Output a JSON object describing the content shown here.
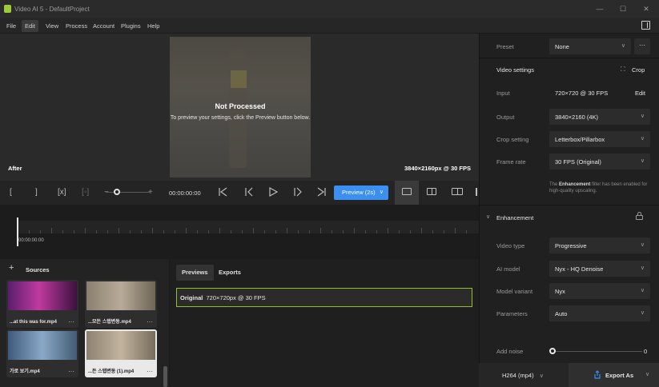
{
  "window": {
    "title": "Video AI 5 - DefaultProject",
    "controls": {
      "minimize": "—",
      "maximize": "☐",
      "close": "✕"
    }
  },
  "menu": [
    "File",
    "Edit",
    "View",
    "Process",
    "Account",
    "Plugins",
    "Help"
  ],
  "viewer": {
    "status_title": "Not Processed",
    "status_hint": "To preview your settings, click the Preview button below.",
    "side_label": "After",
    "resolution_label": "3840×2160px @ 30 FPS"
  },
  "controls": {
    "mark_in": "[",
    "mark_out": "]",
    "clear_marks": "[x]",
    "mark_segment": "[◦]",
    "zoom_minus": "−",
    "zoom_plus": "+",
    "timecode": "00:00:00:00",
    "preview_label": "Preview (2s)",
    "preview_chevron": "∨"
  },
  "timeline": {
    "timecode": "00:00:00:00"
  },
  "sources": {
    "title": "Sources",
    "add": "+",
    "more": "···",
    "items": [
      {
        "label": "...at this was for.mp4"
      },
      {
        "label": "...모든 스탭변동.mp4"
      },
      {
        "label": "가로 보기.mp4"
      },
      {
        "label": "...든 스탭변동 (1).mp4"
      }
    ]
  },
  "outputs": {
    "tabs": [
      "Previews",
      "Exports"
    ],
    "row": {
      "kind": "Original",
      "detail": "720×720px @ 30 FPS"
    }
  },
  "settings": {
    "preset_label": "Preset",
    "preset_value": "None",
    "preset_more": "···",
    "video_settings_title": "Video settings",
    "crop_button": "Crop",
    "input_label": "Input",
    "input_value": "720×720 @ 30 FPS",
    "input_edit": "Edit",
    "output_label": "Output",
    "output_value": "3840×2160 (4K)",
    "crop_setting_label": "Crop setting",
    "crop_setting_value": "Letterbox/Pillarbox",
    "frame_rate_label": "Frame rate",
    "frame_rate_value": "30 FPS (Original)",
    "note_prefix": "The ",
    "note_bold": "Enhancement",
    "note_suffix": " filter has been enabled for high-quality upscaling."
  },
  "enhancement": {
    "title": "Enhancement",
    "video_type_label": "Video type",
    "video_type_value": "Progressive",
    "ai_model_label": "AI model",
    "ai_model_value": "Nyx - HQ Denoise",
    "model_variant_label": "Model variant",
    "model_variant_value": "Nyx",
    "parameters_label": "Parameters",
    "parameters_value": "Auto",
    "add_noise_label": "Add noise",
    "add_noise_value": "0"
  },
  "footer": {
    "codec": "H264 (mp4)",
    "export_label": "Export As"
  },
  "colors": {
    "accent": "#3a8ff0",
    "selection": "#8fbf2a",
    "logo": "#9ccc3c"
  }
}
